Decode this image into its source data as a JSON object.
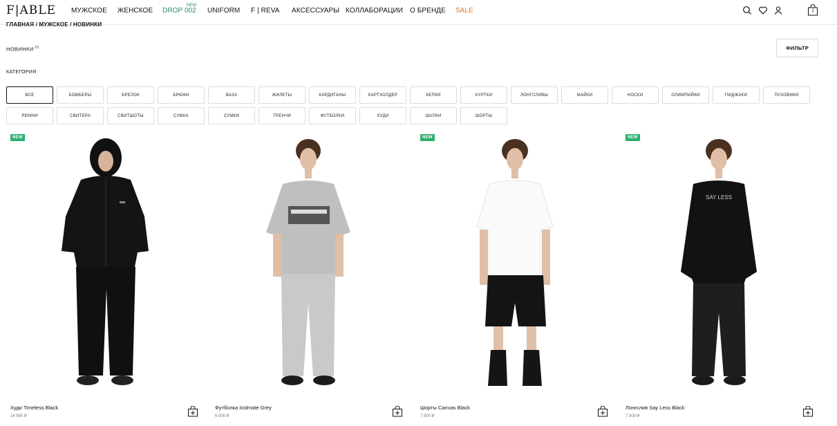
{
  "header": {
    "logo": "F|ABLE",
    "nav": [
      {
        "label": "МУЖСКОЕ"
      },
      {
        "label": "ЖЕНСКОЕ"
      },
      {
        "label": "DROP 002",
        "badge": "NEW",
        "color": "#2c8a63"
      },
      {
        "label": "UNIFORM"
      },
      {
        "label": "F | REVA"
      },
      {
        "label": "АКСЕССУАРЫ"
      },
      {
        "label": "КОЛЛАБОРАЦИИ"
      },
      {
        "label": "О БРЕНДЕ"
      },
      {
        "label": "SALE",
        "color": "#e0782b"
      }
    ],
    "icons": [
      "search-icon",
      "heart-icon",
      "user-icon",
      "bag-icon"
    ],
    "cart_count": "1"
  },
  "breadcrumb": "ГЛАВНАЯ / МУЖСКОЕ / НОВИНКИ",
  "page": {
    "title": "НОВИНКИ",
    "count": "65",
    "filter_label": "ФИЛЬТР",
    "category_label": "КАТЕГОРИЯ"
  },
  "categories_row1": [
    "ВСЕ",
    "БОМБЕРЫ",
    "БРЕЛОК",
    "БРЮКИ",
    "ВАЗА",
    "ЖИЛЕТЫ",
    "КАРДИГАНЫ",
    "КАРТХОЛДЕР",
    "КЕПКИ",
    "КУРТКИ",
    "ЛОНГСЛИВЫ",
    "МАЙКИ",
    "НОСКИ",
    "ОЛИМПИЙКИ",
    "ПИДЖАКИ",
    "ПУХОВИКИ"
  ],
  "categories_row2": [
    "РЕМНИ",
    "СВИТЕРА",
    "СВИТШОТЫ",
    "СУМКА",
    "СУМКИ",
    "ТРЕНЧИ",
    "ФУТБОЛКИ",
    "ХУДИ",
    "ШАПКИ",
    "ШОРТЫ"
  ],
  "products": [
    {
      "name": "Худи Timeless Black",
      "price": "14 900 ₽",
      "badge": "NEW",
      "top_color": "#111111",
      "bottom_color": "#111111"
    },
    {
      "name": "Футболка Icolmate Grey",
      "price": "6 500 ₽",
      "badge": "",
      "top_color": "#bdbdbd",
      "bottom_color": "#c4c4c4"
    },
    {
      "name": "Шорты Canvas Black",
      "price": "7 900 ₽",
      "badge": "NEW",
      "top_color": "#ffffff",
      "bottom_color": "#141414"
    },
    {
      "name": "Лонгслив Say Less Black",
      "price": "7 900 ₽",
      "badge": "NEW",
      "top_color": "#121212",
      "bottom_color": "#1e1e1e",
      "print": "SAY LESS"
    }
  ]
}
